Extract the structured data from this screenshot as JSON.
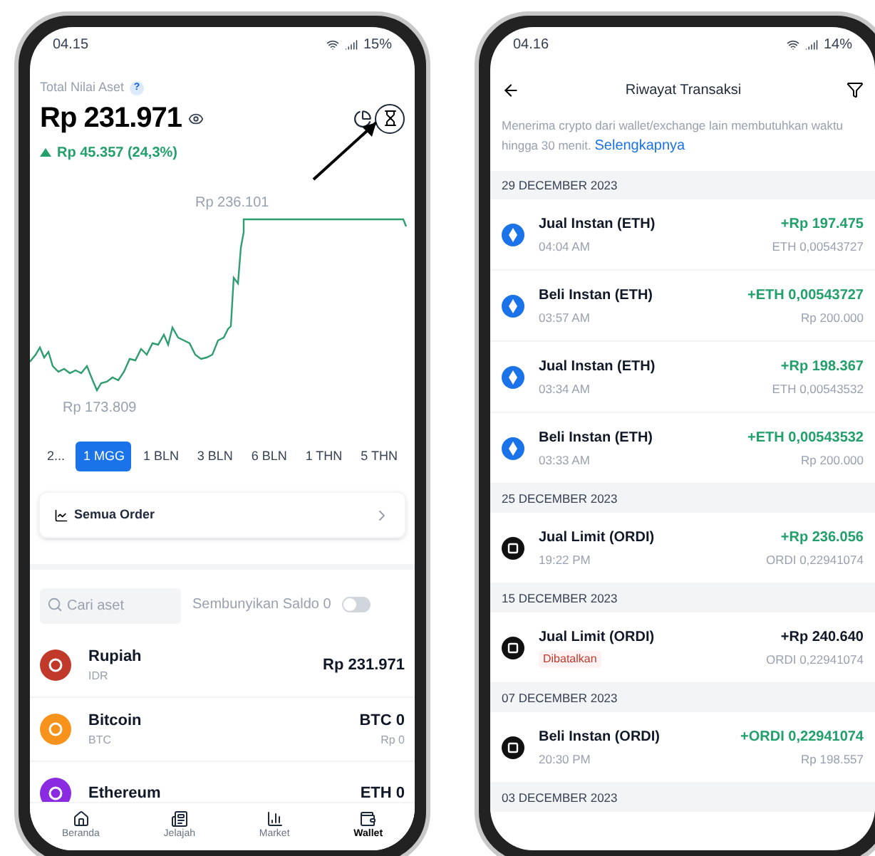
{
  "wallet_screen": {
    "status_bar": {
      "time": "04.15",
      "battery": "15%"
    },
    "total_label": "Total Nilai Aset",
    "help_badge": "?",
    "total_value": "Rp 231.971",
    "change": "Rp 45.357 (24,3%)",
    "chart_labels": {
      "high": "Rp 236.101",
      "low": "Rp 173.809"
    },
    "periods": [
      {
        "label": "2...",
        "selected": false
      },
      {
        "label": "1 MGG",
        "selected": true
      },
      {
        "label": "1 BLN",
        "selected": false
      },
      {
        "label": "3 BLN",
        "selected": false
      },
      {
        "label": "6 BLN",
        "selected": false
      },
      {
        "label": "1 THN",
        "selected": false
      },
      {
        "label": "5 THN",
        "selected": false
      }
    ],
    "orders_link": "Semua Order",
    "search": {
      "placeholder": "Cari aset"
    },
    "hide_zero": {
      "label": "Sembunyikan Saldo 0",
      "on": false
    },
    "assets": [
      {
        "kind": "idr",
        "name": "Rupiah",
        "code": "IDR",
        "amount": "Rp 231.971"
      },
      {
        "kind": "btc",
        "name": "Bitcoin",
        "code": "BTC",
        "amount": "BTC 0",
        "fiat": "Rp 0"
      },
      {
        "kind": "eth",
        "name": "Ethereum",
        "amount": "ETH 0"
      }
    ],
    "nav": [
      {
        "kind": "home",
        "label": "Beranda",
        "selected": false
      },
      {
        "kind": "explore",
        "label": "Jelajah",
        "selected": false
      },
      {
        "kind": "market",
        "label": "Market",
        "selected": false
      },
      {
        "kind": "wallet",
        "label": "Wallet",
        "selected": true
      }
    ]
  },
  "history_screen": {
    "status_bar": {
      "time": "04.16",
      "battery": "14%"
    },
    "title": "Riwayat Transaksi",
    "notice": "Menerima crypto dari wallet/exchange lain membutuhkan waktu hingga 30 menit.",
    "notice_link": "Selengkapnya",
    "groups": [
      {
        "date": "29 DECEMBER 2023",
        "rows": [
          {
            "kind": "eth",
            "title": "Jual Instan (ETH)",
            "time": "04:04 AM",
            "amount": "+Rp 197.475",
            "sub": "ETH 0,00543727",
            "cancelled": false
          },
          {
            "kind": "eth",
            "title": "Beli Instan (ETH)",
            "time": "03:57 AM",
            "amount": "+ETH 0,00543727",
            "sub": "Rp 200.000",
            "cancelled": false
          },
          {
            "kind": "eth",
            "title": "Jual Instan (ETH)",
            "time": "03:34 AM",
            "amount": "+Rp 198.367",
            "sub": "ETH 0,00543532",
            "cancelled": false
          },
          {
            "kind": "eth",
            "title": "Beli Instan (ETH)",
            "time": "03:33 AM",
            "amount": "+ETH 0,00543532",
            "sub": "Rp 200.000",
            "cancelled": false
          }
        ]
      },
      {
        "date": "25 DECEMBER 2023",
        "rows": [
          {
            "kind": "ordi",
            "title": "Jual Limit (ORDI)",
            "time": "19:22 PM",
            "amount": "+Rp 236.056",
            "sub": "ORDI 0,22941074",
            "cancelled": false
          }
        ]
      },
      {
        "date": "15 DECEMBER 2023",
        "rows": [
          {
            "kind": "ordi",
            "title": "Jual Limit (ORDI)",
            "badge": "Dibatalkan",
            "amount": "+Rp 240.640",
            "sub": "ORDI 0,22941074",
            "cancelled": true
          }
        ]
      },
      {
        "date": "07 DECEMBER 2023",
        "rows": [
          {
            "kind": "ordi",
            "title": "Beli Instan (ORDI)",
            "time": "20:30 PM",
            "amount": "+ORDI 0,22941074",
            "sub": "Rp 198.557",
            "cancelled": false
          }
        ]
      },
      {
        "date": "03 DECEMBER 2023"
      }
    ]
  }
}
